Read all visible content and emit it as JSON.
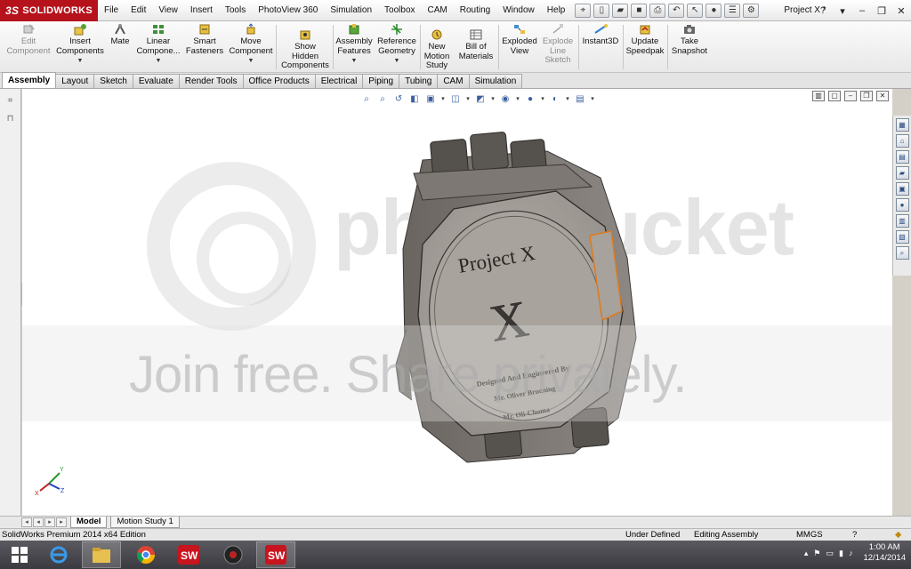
{
  "app": {
    "logo_prefix": "3S",
    "logo_text": "SOLIDWORKS",
    "document_title": "Project X *"
  },
  "menu": [
    "File",
    "Edit",
    "View",
    "Insert",
    "Tools",
    "PhotoView 360",
    "Simulation",
    "Toolbox",
    "CAM",
    "Routing",
    "Window",
    "Help"
  ],
  "command_manager": [
    {
      "label_1": "Edit",
      "label_2": "Component",
      "enabled": false,
      "icon": "edit-component-icon"
    },
    {
      "label_1": "Insert",
      "label_2": "Components",
      "enabled": true,
      "icon": "insert-components-icon",
      "dropdown": true
    },
    {
      "label_1": "Mate",
      "label_2": "",
      "enabled": true,
      "icon": "mate-icon"
    },
    {
      "label_1": "Linear",
      "label_2": "Compone...",
      "enabled": true,
      "icon": "linear-pattern-icon",
      "dropdown": true
    },
    {
      "label_1": "Smart",
      "label_2": "Fasteners",
      "enabled": true,
      "icon": "smart-fasteners-icon"
    },
    {
      "label_1": "Move",
      "label_2": "Component",
      "enabled": true,
      "icon": "move-component-icon",
      "dropdown": true
    },
    {
      "label_1": "Show",
      "label_2": "Hidden",
      "label_3": "Components",
      "enabled": true,
      "icon": "show-hidden-icon"
    },
    {
      "label_1": "Assembly",
      "label_2": "Features",
      "enabled": true,
      "icon": "assembly-features-icon",
      "dropdown": true
    },
    {
      "label_1": "Reference",
      "label_2": "Geometry",
      "enabled": true,
      "icon": "reference-geometry-icon",
      "dropdown": true
    },
    {
      "label_1": "New",
      "label_2": "Motion",
      "label_3": "Study",
      "enabled": true,
      "icon": "motion-study-icon"
    },
    {
      "label_1": "Bill of",
      "label_2": "Materials",
      "enabled": true,
      "icon": "bom-icon"
    },
    {
      "label_1": "Exploded",
      "label_2": "View",
      "enabled": true,
      "icon": "exploded-view-icon"
    },
    {
      "label_1": "Explode",
      "label_2": "Line",
      "label_3": "Sketch",
      "enabled": false,
      "icon": "explode-line-icon"
    },
    {
      "label_1": "Instant3D",
      "label_2": "",
      "enabled": true,
      "icon": "instant3d-icon"
    },
    {
      "label_1": "Update",
      "label_2": "Speedpak",
      "enabled": true,
      "icon": "speedpak-icon"
    },
    {
      "label_1": "Take",
      "label_2": "Snapshot",
      "enabled": true,
      "icon": "snapshot-icon"
    }
  ],
  "tabs": [
    "Assembly",
    "Layout",
    "Sketch",
    "Evaluate",
    "Render Tools",
    "Office Products",
    "Electrical",
    "Piping",
    "Tubing",
    "CAM",
    "Simulation"
  ],
  "active_tab": "Assembly",
  "model": {
    "engraving_title": "Project X",
    "engraving_letter": "X",
    "engraving_line1": "Designed And Engineered By",
    "engraving_line2": "Mr. Oliver Bruening",
    "engraving_line3": "Mr. Oli-Chuma"
  },
  "watermark": {
    "brand": "photobucket",
    "tagline": "Join free. Share privately."
  },
  "triad": {
    "x": "X",
    "y": "Y",
    "z": "Z"
  },
  "bottom_tabs": [
    "Model",
    "Motion Study 1"
  ],
  "status": {
    "edition": "SolidWorks Premium 2014 x64 Edition",
    "state": "Under Defined",
    "mode": "Editing Assembly",
    "units": "MMGS",
    "help": "?"
  },
  "taskbar": {
    "time": "1:00 AM",
    "date": "12/14/2014"
  },
  "colors": {
    "brand_red": "#b5121b",
    "model_body": "#8a8580",
    "model_face": "#a39e98",
    "selection_orange": "#e07a1c"
  }
}
